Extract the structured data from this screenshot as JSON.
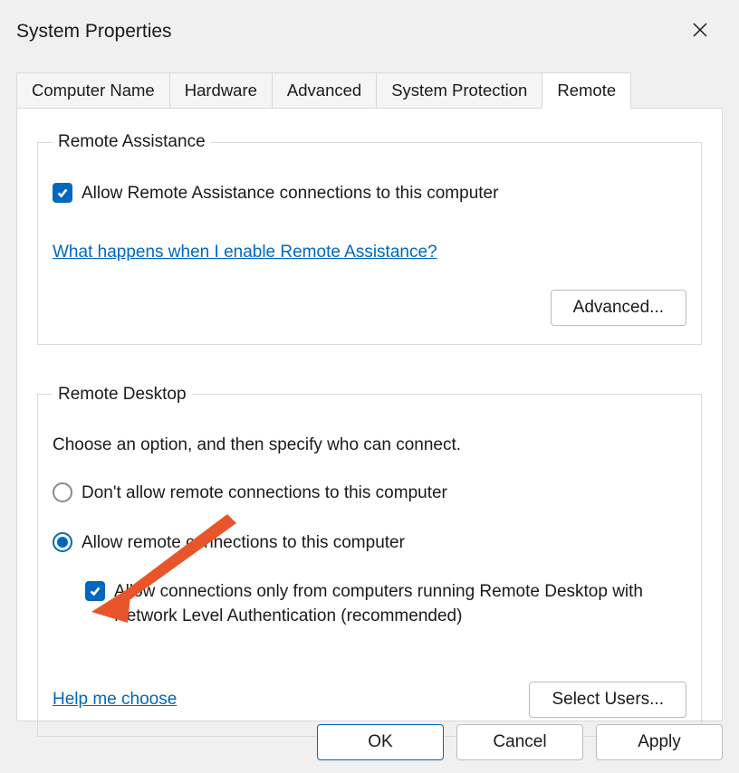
{
  "title": "System Properties",
  "tabs": [
    {
      "label": "Computer Name"
    },
    {
      "label": "Hardware"
    },
    {
      "label": "Advanced"
    },
    {
      "label": "System Protection"
    },
    {
      "label": "Remote"
    }
  ],
  "remote_assistance": {
    "legend": "Remote Assistance",
    "allow_label": "Allow Remote Assistance connections to this computer",
    "help_link": "What happens when I enable Remote Assistance?",
    "advanced_btn": "Advanced..."
  },
  "remote_desktop": {
    "legend": "Remote Desktop",
    "instruction": "Choose an option, and then specify who can connect.",
    "option_deny": "Don't allow remote connections to this computer",
    "option_allow": "Allow remote connections to this computer",
    "nla_label": "Allow connections only from computers running Remote Desktop with Network Level Authentication (recommended)",
    "help_link": "Help me choose",
    "select_users_btn": "Select Users..."
  },
  "buttons": {
    "ok": "OK",
    "cancel": "Cancel",
    "apply": "Apply"
  }
}
